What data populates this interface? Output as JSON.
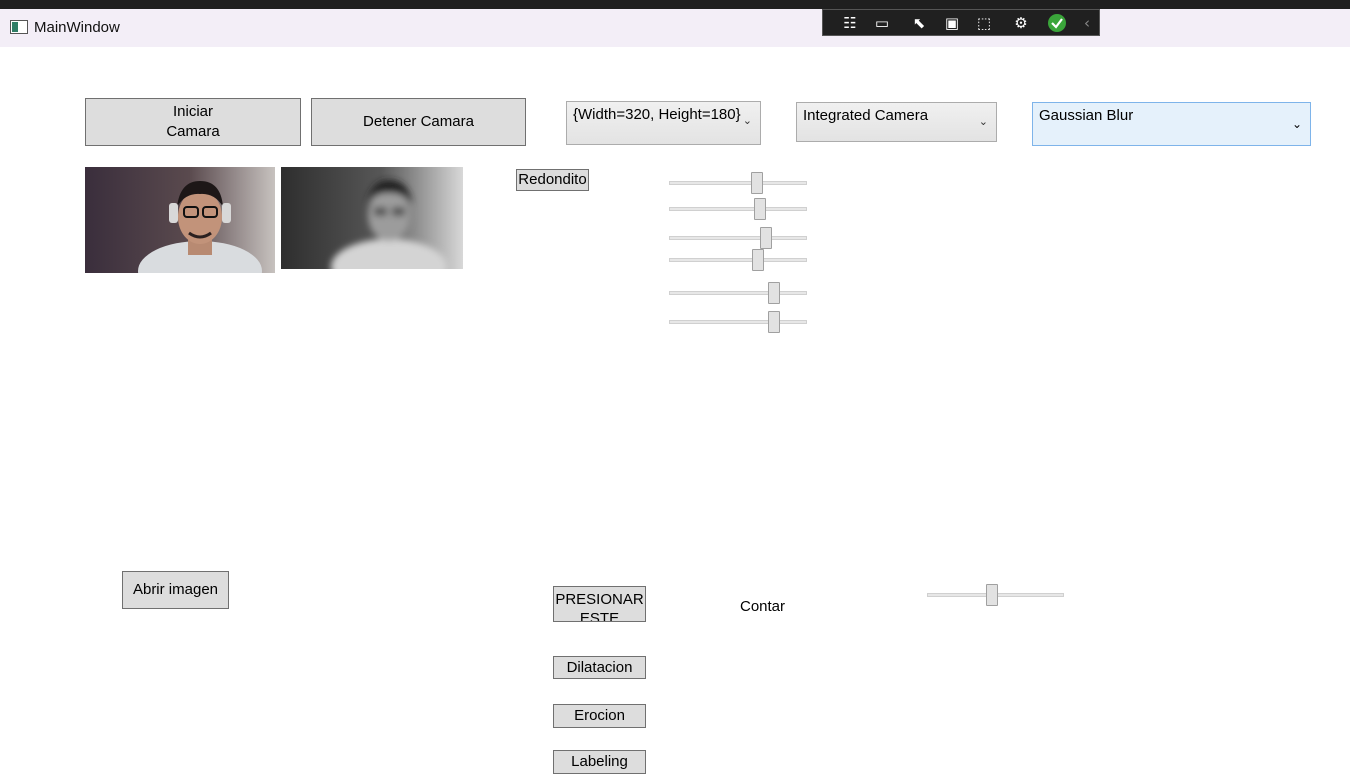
{
  "window": {
    "title": "MainWindow",
    "icon": "app-window-icon"
  },
  "debug_toolbar": {
    "icons": [
      "live-visual-tree-icon",
      "camera-icon",
      "select-element-icon",
      "display-layout-adorners-icon",
      "track-focus-icon",
      "binding-failures-icon",
      "hot-reload-ok-icon",
      "collapse-toolbar-icon"
    ]
  },
  "buttons": {
    "start_camera": "Iniciar\nCamara",
    "stop_camera": "Detener Camara",
    "redondito": "Redondito",
    "open_image": "Abrir imagen",
    "press_this": "PRESIONAR\nESTE",
    "dilation": "Dilatacion",
    "erosion": "Erocion",
    "labeling": "Labeling"
  },
  "combos": {
    "resolution": "{Width=320, Height=180}",
    "camera": "Integrated Camera",
    "filter": "Gaussian Blur"
  },
  "labels": {
    "count": "Contar"
  },
  "sliders": [
    {
      "name": "slider-1",
      "value": 0.64
    },
    {
      "name": "slider-2",
      "value": 0.66
    },
    {
      "name": "slider-3",
      "value": 0.7
    },
    {
      "name": "slider-4",
      "value": 0.65
    },
    {
      "name": "slider-5",
      "value": 0.76
    },
    {
      "name": "slider-6",
      "value": 0.76
    },
    {
      "name": "slider-7",
      "value": 0.48
    }
  ],
  "images": {
    "original": "webcam-original-image",
    "filtered": "webcam-blurred-grayscale-image"
  }
}
